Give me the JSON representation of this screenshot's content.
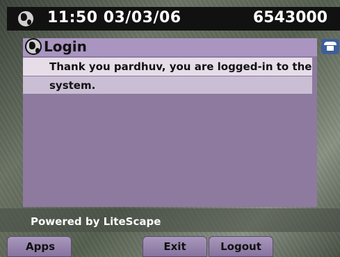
{
  "status_bar": {
    "time_date": "11:50 03/03/06",
    "line_number": "6543000"
  },
  "window": {
    "title": "Login",
    "message_line1": "Thank you pardhuv, you are logged-in to the",
    "message_line2": "system."
  },
  "footer": {
    "powered_by": "Powered by LiteScape"
  },
  "softkeys": {
    "apps": "Apps",
    "exit": "Exit",
    "logout": "Logout"
  },
  "icons": {
    "status": "globe-icon",
    "title": "globe-icon",
    "line": "phone-icon"
  },
  "colors": {
    "panel": "#8d7a9e",
    "title_bar": "#a995c0",
    "highlight": "#e6dde9",
    "softkey": "#9a88ae"
  }
}
